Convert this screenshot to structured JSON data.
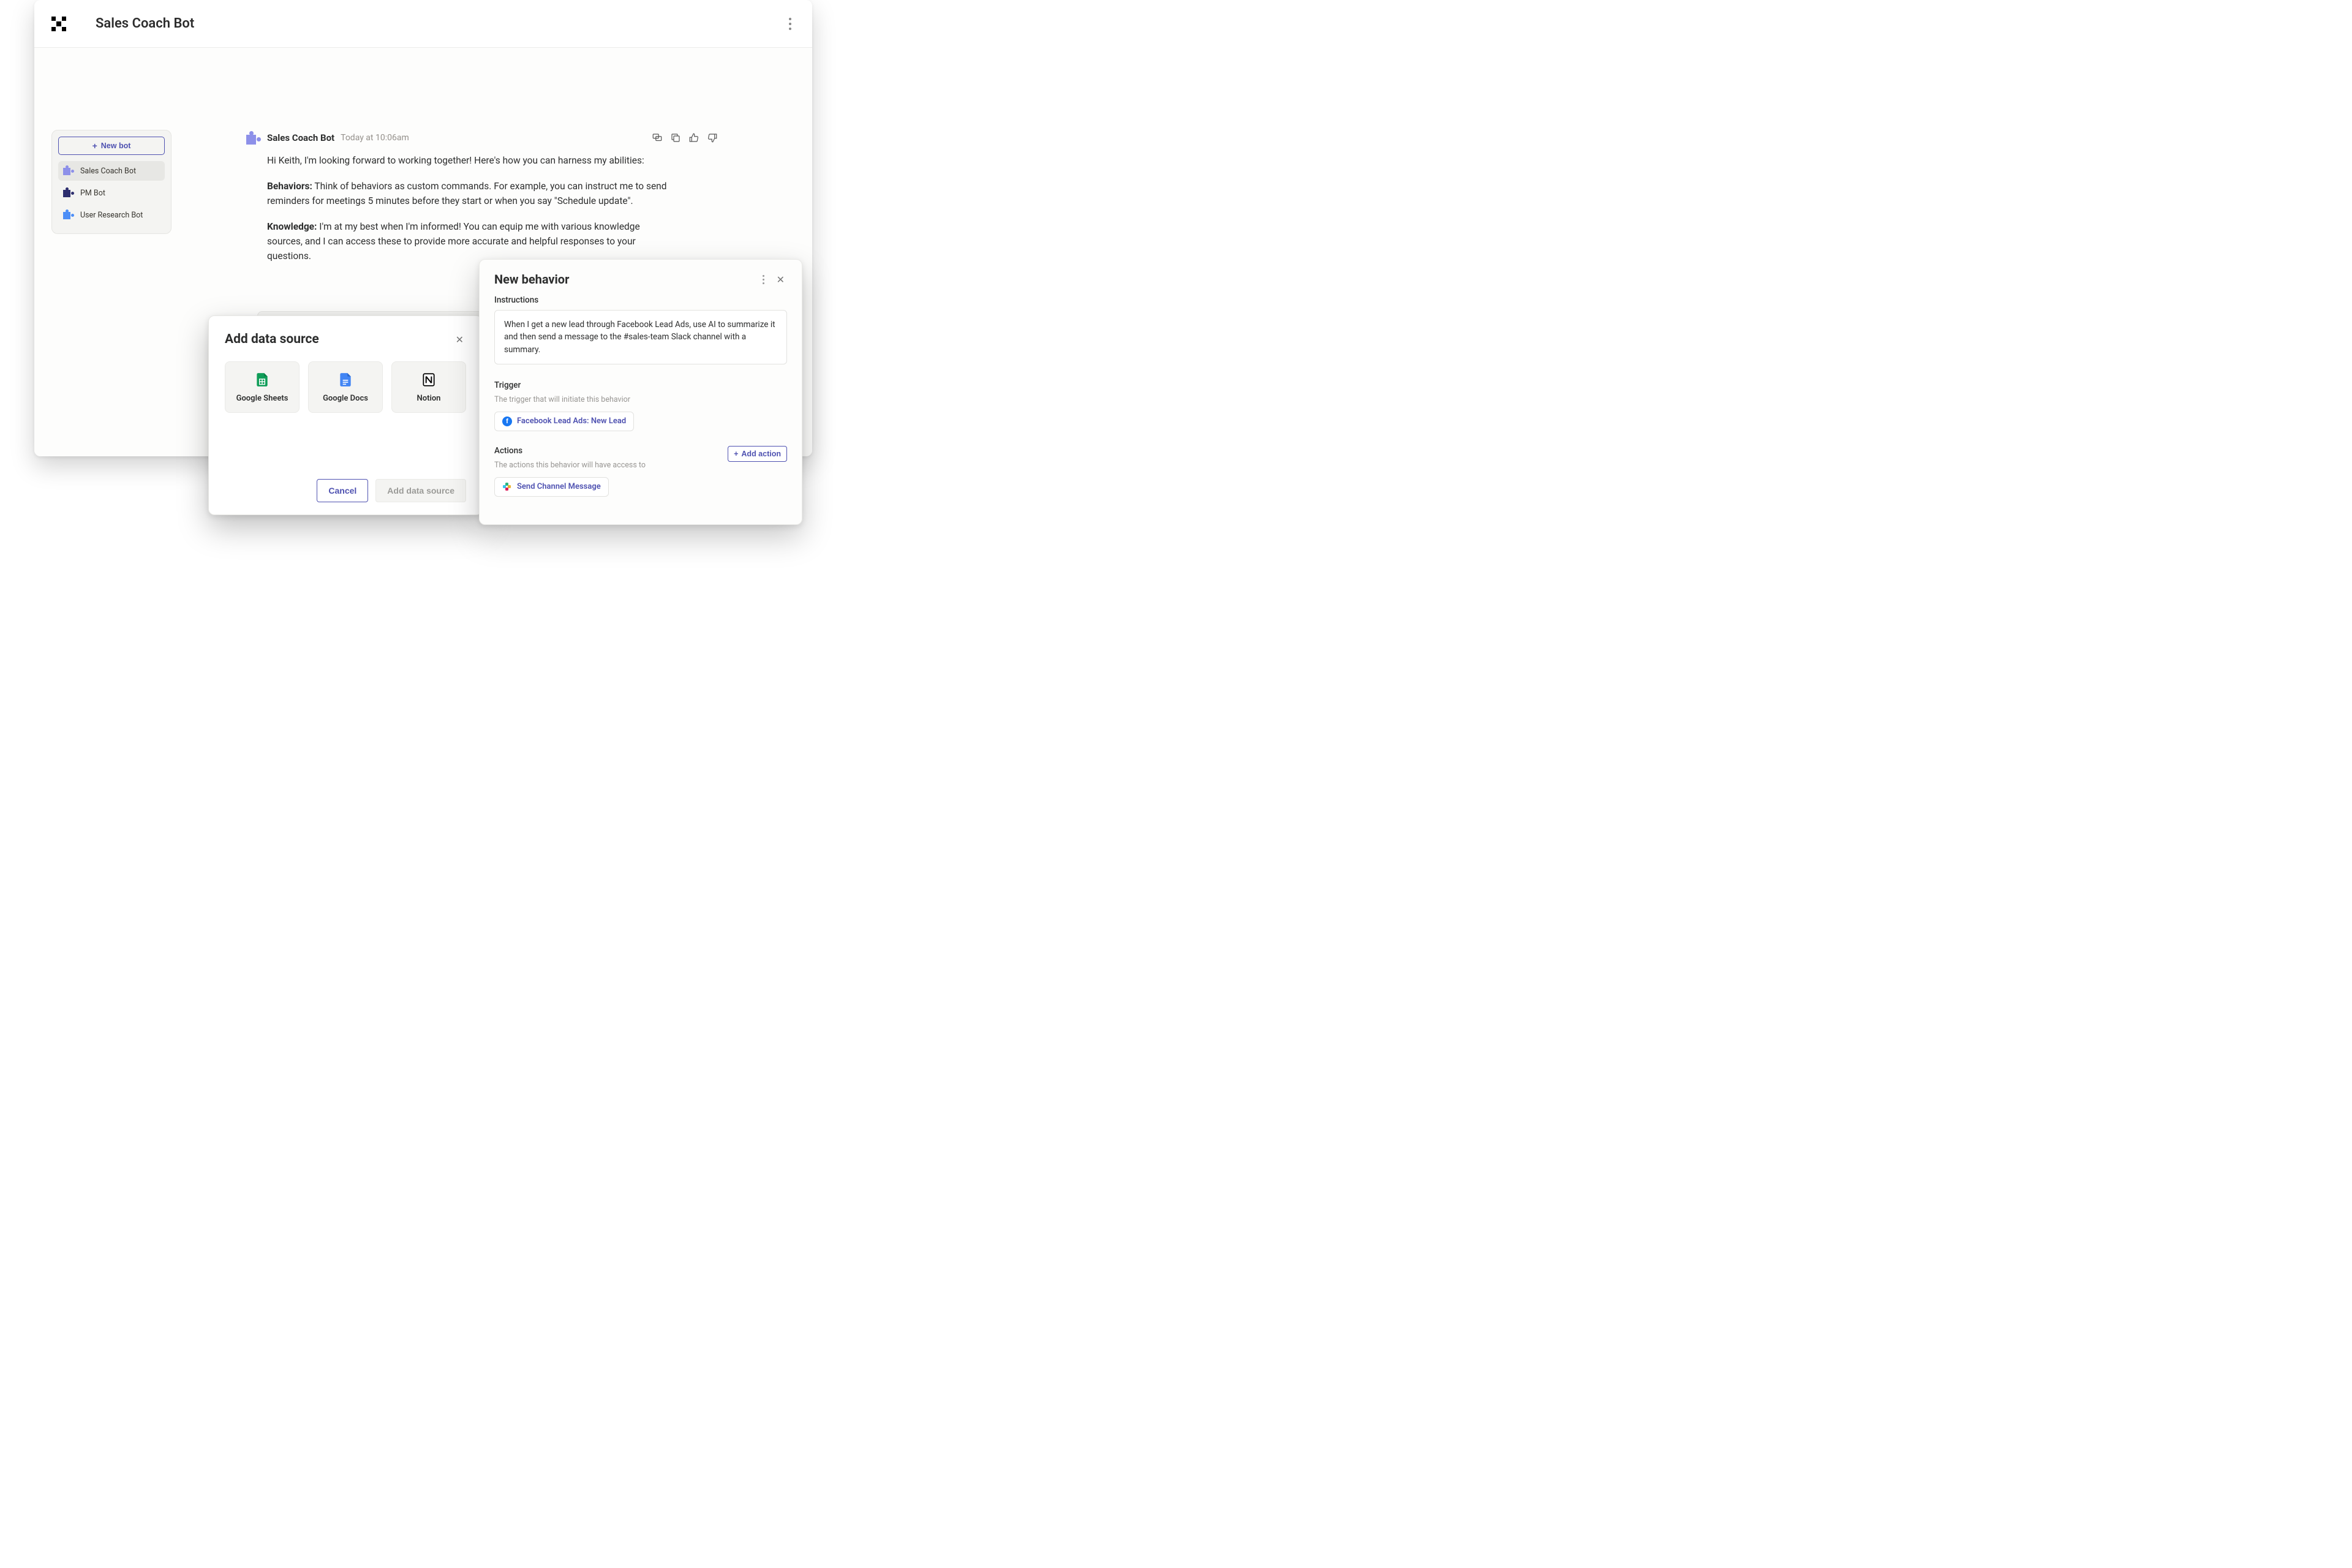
{
  "header": {
    "title": "Sales Coach Bot"
  },
  "sidebar": {
    "new_bot_label": "New bot",
    "items": [
      {
        "label": "Sales Coach Bot"
      },
      {
        "label": "PM Bot"
      },
      {
        "label": "User Research Bot"
      }
    ]
  },
  "message": {
    "bot_name": "Sales Coach Bot",
    "timestamp": "Today at 10:06am",
    "greeting": "Hi Keith, I'm looking forward to working together! Here's how you can harness my abilities:",
    "behaviors_label": "Behaviors:",
    "behaviors_text": " Think of behaviors as custom commands.  For example, you can instruct me to send reminders for meetings 5 minutes before they start or when you say \"Schedule update\".",
    "knowledge_label": "Knowledge:",
    "knowledge_text": " I'm at my best when I'm informed! You can equip me with various knowledge sources, and I can access these to provide more accurate and helpful responses to your questions."
  },
  "data_source_modal": {
    "title": "Add data source",
    "options": [
      {
        "label": "Google Sheets"
      },
      {
        "label": "Google Docs"
      },
      {
        "label": "Notion"
      }
    ],
    "cancel_label": "Cancel",
    "submit_label": "Add data source"
  },
  "behavior_panel": {
    "title": "New behavior",
    "instructions_label": "Instructions",
    "instructions_value": "When I get a new lead through Facebook Lead Ads, use AI to summarize it and then send a message to the #sales-team Slack channel with a summary.",
    "trigger_label": "Trigger",
    "trigger_desc": "The trigger that will initiate this behavior",
    "trigger_chip": "Facebook Lead Ads: New Lead",
    "actions_label": "Actions",
    "actions_desc": "The actions this behavior will have access to",
    "add_action_label": "Add action",
    "action_chip": "Send Channel Message"
  }
}
